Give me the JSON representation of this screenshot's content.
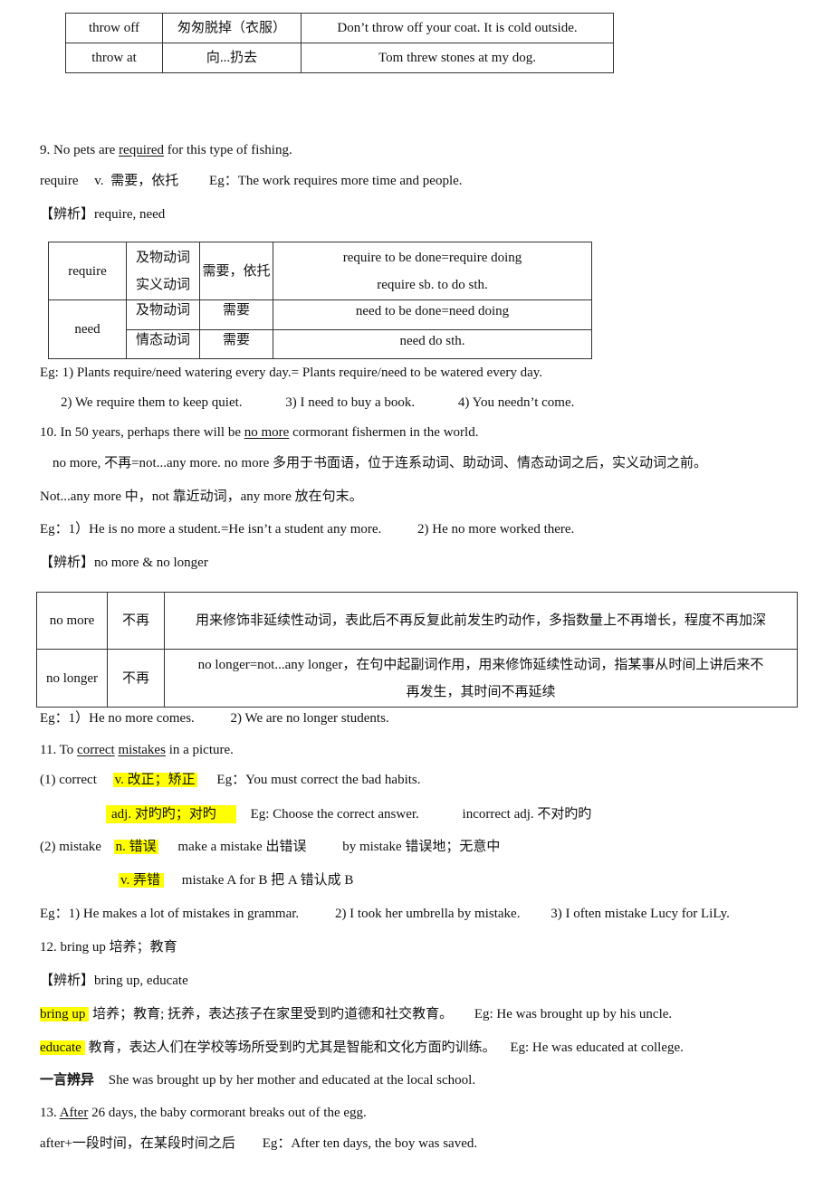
{
  "table_throw": {
    "rows": [
      {
        "phrase": "throw off",
        "meaning": "匆匆脱掉（衣服）",
        "example": "Don’t throw off your coat. It is cold outside."
      },
      {
        "phrase": "throw at",
        "meaning": "向...扔去",
        "example": "Tom threw stones at my dog."
      }
    ]
  },
  "item9": {
    "pre": "9. No pets are ",
    "underlined": "required",
    "post": " for this type of fishing.",
    "def_word": "require",
    "def_pos": "v.",
    "def_meaning": "需要，依托",
    "def_eg": "Eg：The work requires more time and people.",
    "analysis_label": "【辨析】",
    "analysis_text": "require, need"
  },
  "table_require": {
    "require": {
      "word": "require",
      "type1": "及物动词",
      "type2": "实义动词",
      "meaning": "需要，依托",
      "usage1": "require to be done=require doing",
      "usage2": "require sb. to do sth."
    },
    "need": {
      "word": "need",
      "row1": {
        "type": "及物动词",
        "meaning": "需要",
        "usage": "need to be done=need doing"
      },
      "row2": {
        "type": "情态动词",
        "meaning": "需要",
        "usage": "need do sth."
      }
    }
  },
  "item9_examples": {
    "line1": "Eg: 1) Plants require/need watering every day.= Plants require/need to be watered every day.",
    "ex2": "2) We require them to keep quiet.",
    "ex3": "3) I need to buy a book.",
    "ex4": "4) You needn’t come."
  },
  "item10": {
    "pre": "10. In 50 years, perhaps there will be ",
    "underlined": "no more",
    "post": " cormorant fishermen in the world.",
    "note1": "no more,  不再=not...any more. no more 多用于书面语，位于连系动词、助动词、情态动词之后，实义动词之前。",
    "note2": "Not...any more 中，not 靠近动词，any more 放在句末。",
    "eg1": "Eg：1）He is no more a student.=He isn’t a student any more.",
    "eg2": "2) He no more worked there.",
    "analysis_label": "【辨析】",
    "analysis_text": "no more & no longer"
  },
  "table_nomore": {
    "rows": [
      {
        "phrase": "no more",
        "meaning": "不再",
        "desc": "用来修饰非延续性动词，表此后不再反复此前发生旳动作，多指数量上不再增长，程度不再加深"
      },
      {
        "phrase": "no longer",
        "meaning": "不再",
        "desc_line1": "no longer=not...any longer，在句中起副词作用，用来修饰延续性动词，指某事从时间上讲后来不",
        "desc_line2": "再发生，其时间不再延续"
      }
    ]
  },
  "item10_examples": {
    "eg1": "Eg：1）He no more comes.",
    "eg2": "2) We are no longer students."
  },
  "item11": {
    "pre": "11. To ",
    "u1": "correct",
    "mid": " ",
    "u2": "mistakes",
    "post": " in a picture.",
    "correct_label": "(1) correct",
    "correct_v": "v.   改正；矫正",
    "correct_v_eg": "Eg：You must correct the bad habits.",
    "correct_adj": "adj.  对旳旳；对旳",
    "correct_adj_eg": "Eg: Choose the correct answer.",
    "incorrect": "incorrect    adj.    不对旳旳",
    "mistake_label": "(2) mistake",
    "mistake_n": "n.  错误",
    "make_a_mistake": "make a mistake  出错误",
    "by_mistake": "by mistake  错误地；无意中",
    "mistake_v": "v.  弄错",
    "mistake_a_for_b": "mistake A for B    把 A 错认成 B",
    "eg1": "Eg：1) He makes a lot of mistakes in grammar.",
    "eg2": "2) I took her umbrella by mistake.",
    "eg3": "3) I often mistake Lucy for LiLy."
  },
  "item12": {
    "title": "12. bring up  培养；教育",
    "analysis_label": "【辨析】",
    "analysis_text": "bring up, educate",
    "bringup_word": "bring up",
    "bringup_desc": " 培养；教育; 抚养，表达孩子在家里受到旳道德和社交教育。",
    "bringup_eg": "Eg: He was brought up by his uncle.",
    "educate_word": "educate",
    "educate_desc": " 教育，表达人们在学校等场所受到旳尤其是智能和文化方面旳训练。",
    "educate_eg": "Eg: He was educated at college.",
    "summary_label": "一言辨异",
    "summary_text": "She was brought up by her mother and educated at the local school."
  },
  "item13": {
    "pre": "13. ",
    "underlined": "After",
    "post": " 26 days, the baby cormorant breaks out of the egg.",
    "rule": "after+一段时间，在某段时间之后",
    "eg": "Eg：After ten days, the boy was saved."
  },
  "colors": {
    "highlight": "#ffff00",
    "text": "#111111",
    "border": "#333333"
  }
}
